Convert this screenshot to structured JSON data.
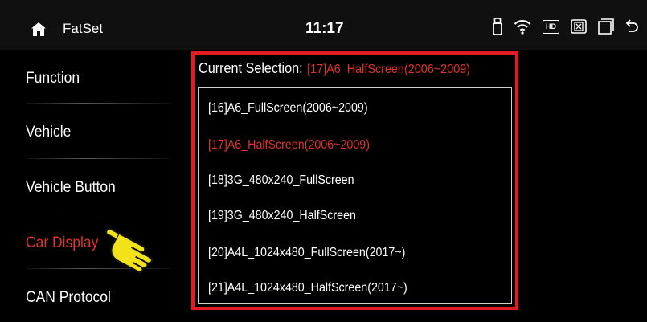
{
  "status_bar": {
    "app_title": "FatSet",
    "time": "11:17",
    "icons": [
      "home-icon",
      "usb-icon",
      "wifi-icon",
      "hd-icon",
      "close-box-icon",
      "window-icon",
      "back-icon"
    ],
    "hd_label": "HD"
  },
  "sidebar": {
    "items": [
      {
        "label": "Function"
      },
      {
        "label": "Vehicle"
      },
      {
        "label": "Vehicle Button"
      },
      {
        "label": "Car Display",
        "active": true
      },
      {
        "label": "CAN Protocol"
      }
    ],
    "accent_color": "#e0312b",
    "pointer_icon": "pointing-hand-icon"
  },
  "panel": {
    "current_label": "Current Selection:",
    "current_value": "[17]A6_HalfScreen(2006~2009)",
    "frame_color": "#e11c24",
    "options": [
      {
        "label": "[16]A6_FullScreen(2006~2009)"
      },
      {
        "label": "[17]A6_HalfScreen(2006~2009)",
        "selected": true
      },
      {
        "label": "[18]3G_480x240_FullScreen"
      },
      {
        "label": "[19]3G_480x240_HalfScreen"
      },
      {
        "label": "[20]A4L_1024x480_FullScreen(2017~)"
      },
      {
        "label": "[21]A4L_1024x480_HalfScreen(2017~)"
      }
    ]
  }
}
